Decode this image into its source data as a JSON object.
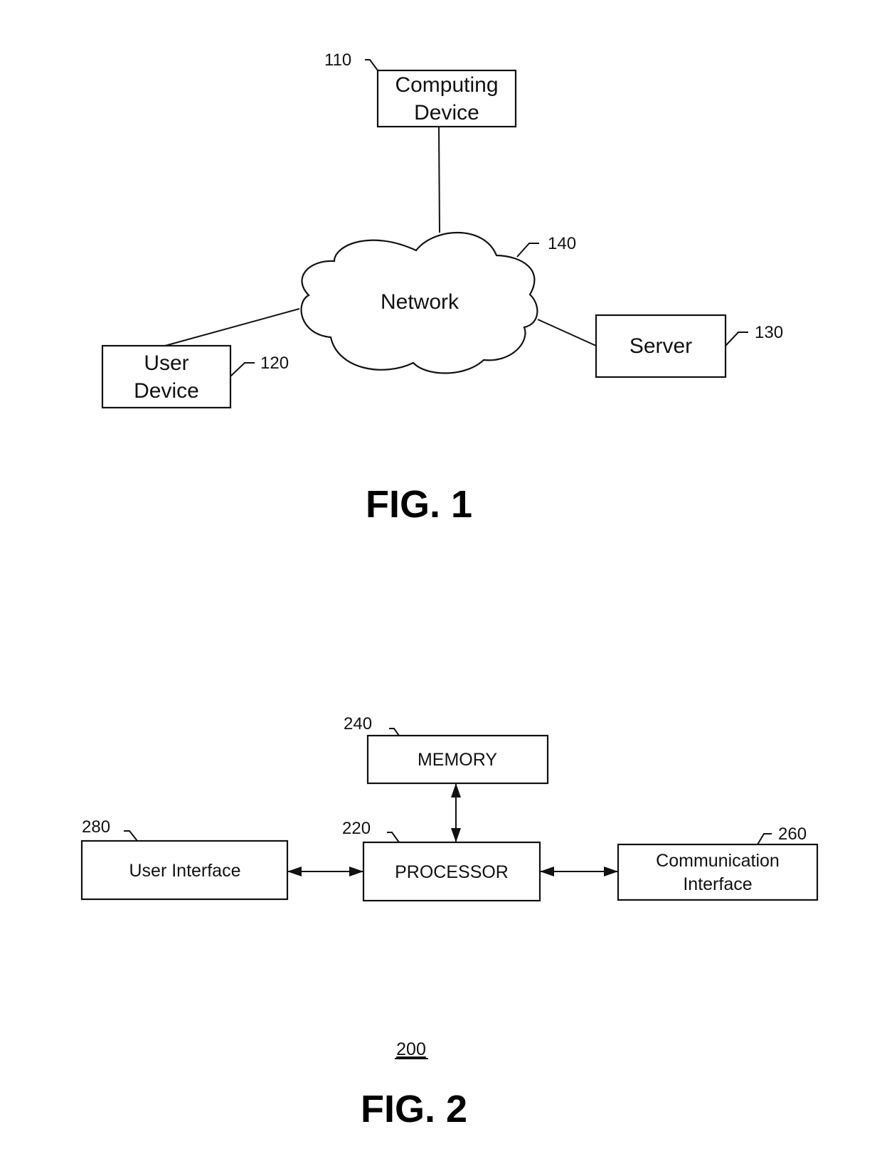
{
  "fig1": {
    "caption": "FIG. 1",
    "computing_device": {
      "ref": "110",
      "line1": "Computing",
      "line2": "Device"
    },
    "user_device": {
      "ref": "120",
      "line1": "User",
      "line2": "Device"
    },
    "server": {
      "ref": "130",
      "label": "Server"
    },
    "network": {
      "ref": "140",
      "label": "Network"
    }
  },
  "fig2": {
    "caption": "FIG. 2",
    "system_ref": "200",
    "memory": {
      "ref": "240",
      "label": "MEMORY"
    },
    "processor": {
      "ref": "220",
      "label": "PROCESSOR"
    },
    "user_interface": {
      "ref": "280",
      "label": "User Interface"
    },
    "communication_interface": {
      "ref": "260",
      "line1": "Communication",
      "line2": "Interface"
    }
  }
}
